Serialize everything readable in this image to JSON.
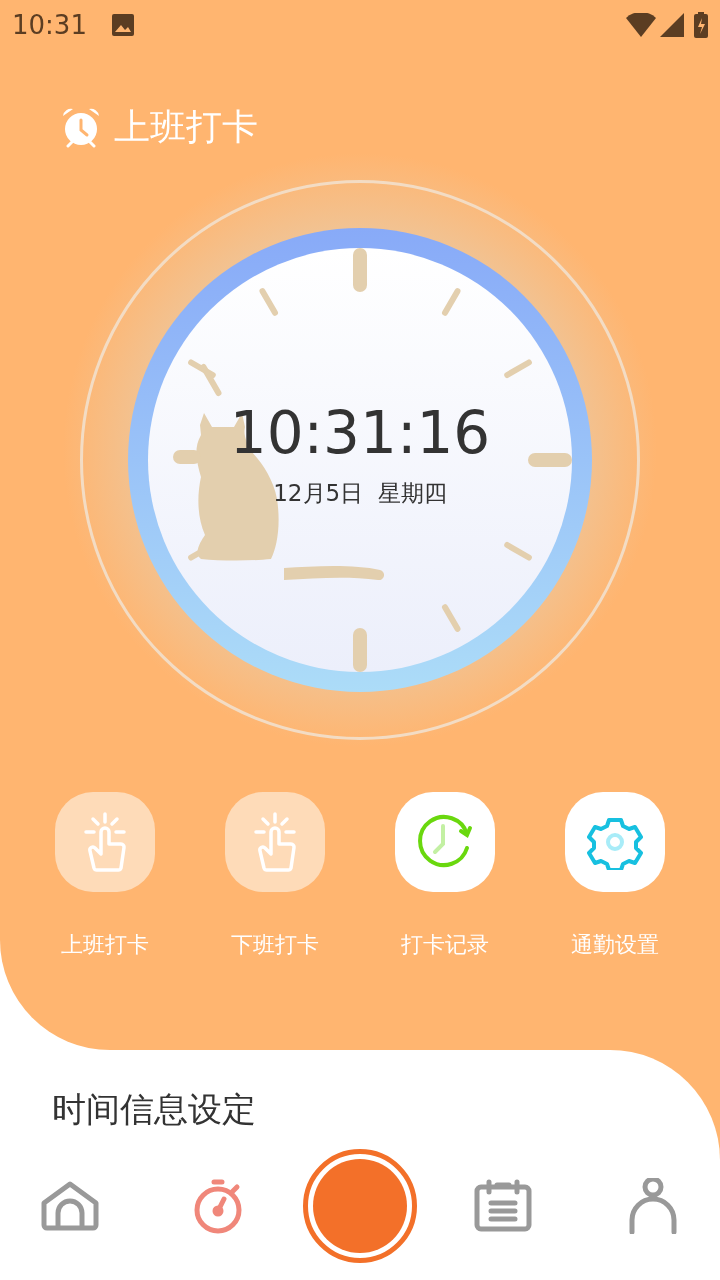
{
  "status_bar": {
    "time": "10:31"
  },
  "header": {
    "title": "上班打卡"
  },
  "clock": {
    "time": "10:31:16",
    "date": "12月5日  星期四"
  },
  "actions": [
    {
      "kind": "clock_in",
      "label": "上班打卡"
    },
    {
      "kind": "clock_out",
      "label": "下班打卡"
    },
    {
      "kind": "records",
      "label": "打卡记录"
    },
    {
      "kind": "settings",
      "label": "通勤设置"
    }
  ],
  "section": {
    "title": "时间信息设定"
  },
  "bottom_nav": [
    {
      "kind": "home",
      "selected": false
    },
    {
      "kind": "work",
      "selected": true
    },
    {
      "kind": "center",
      "selected": false
    },
    {
      "kind": "hours",
      "selected": false
    },
    {
      "kind": "mine",
      "selected": false
    }
  ]
}
